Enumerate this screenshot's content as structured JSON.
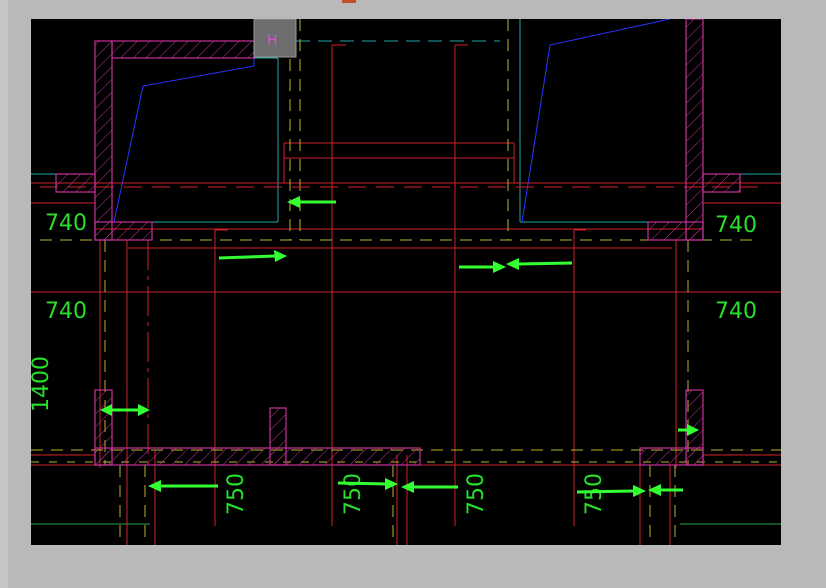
{
  "window": {
    "background": "#b9b9b9",
    "viewport_background": "#000000"
  },
  "colors": {
    "wall": "#c8309a",
    "red_line": "#d0202a",
    "yellow_line": "#b9b52a",
    "cyan_line": "#22a3a3",
    "blue_line": "#2a35ff",
    "dim_text": "#27e02a",
    "arrow": "#33ff33"
  },
  "section_marker": {
    "label": "H",
    "icon": "section-marker-icon"
  },
  "dimensions": {
    "top_left": "740",
    "top_right": "740",
    "mid_left": "740",
    "mid_right": "740",
    "side_left": "1400",
    "bottom_1": "750",
    "bottom_2": "750",
    "bottom_3": "750",
    "bottom_4": "750"
  },
  "annotation_arrows": [
    {
      "direction": "left"
    },
    {
      "direction": "right"
    },
    {
      "direction": "right"
    },
    {
      "direction": "left"
    },
    {
      "direction": "double"
    },
    {
      "direction": "right"
    },
    {
      "direction": "left"
    },
    {
      "direction": "right"
    },
    {
      "direction": "left"
    },
    {
      "direction": "right"
    },
    {
      "direction": "left"
    }
  ]
}
